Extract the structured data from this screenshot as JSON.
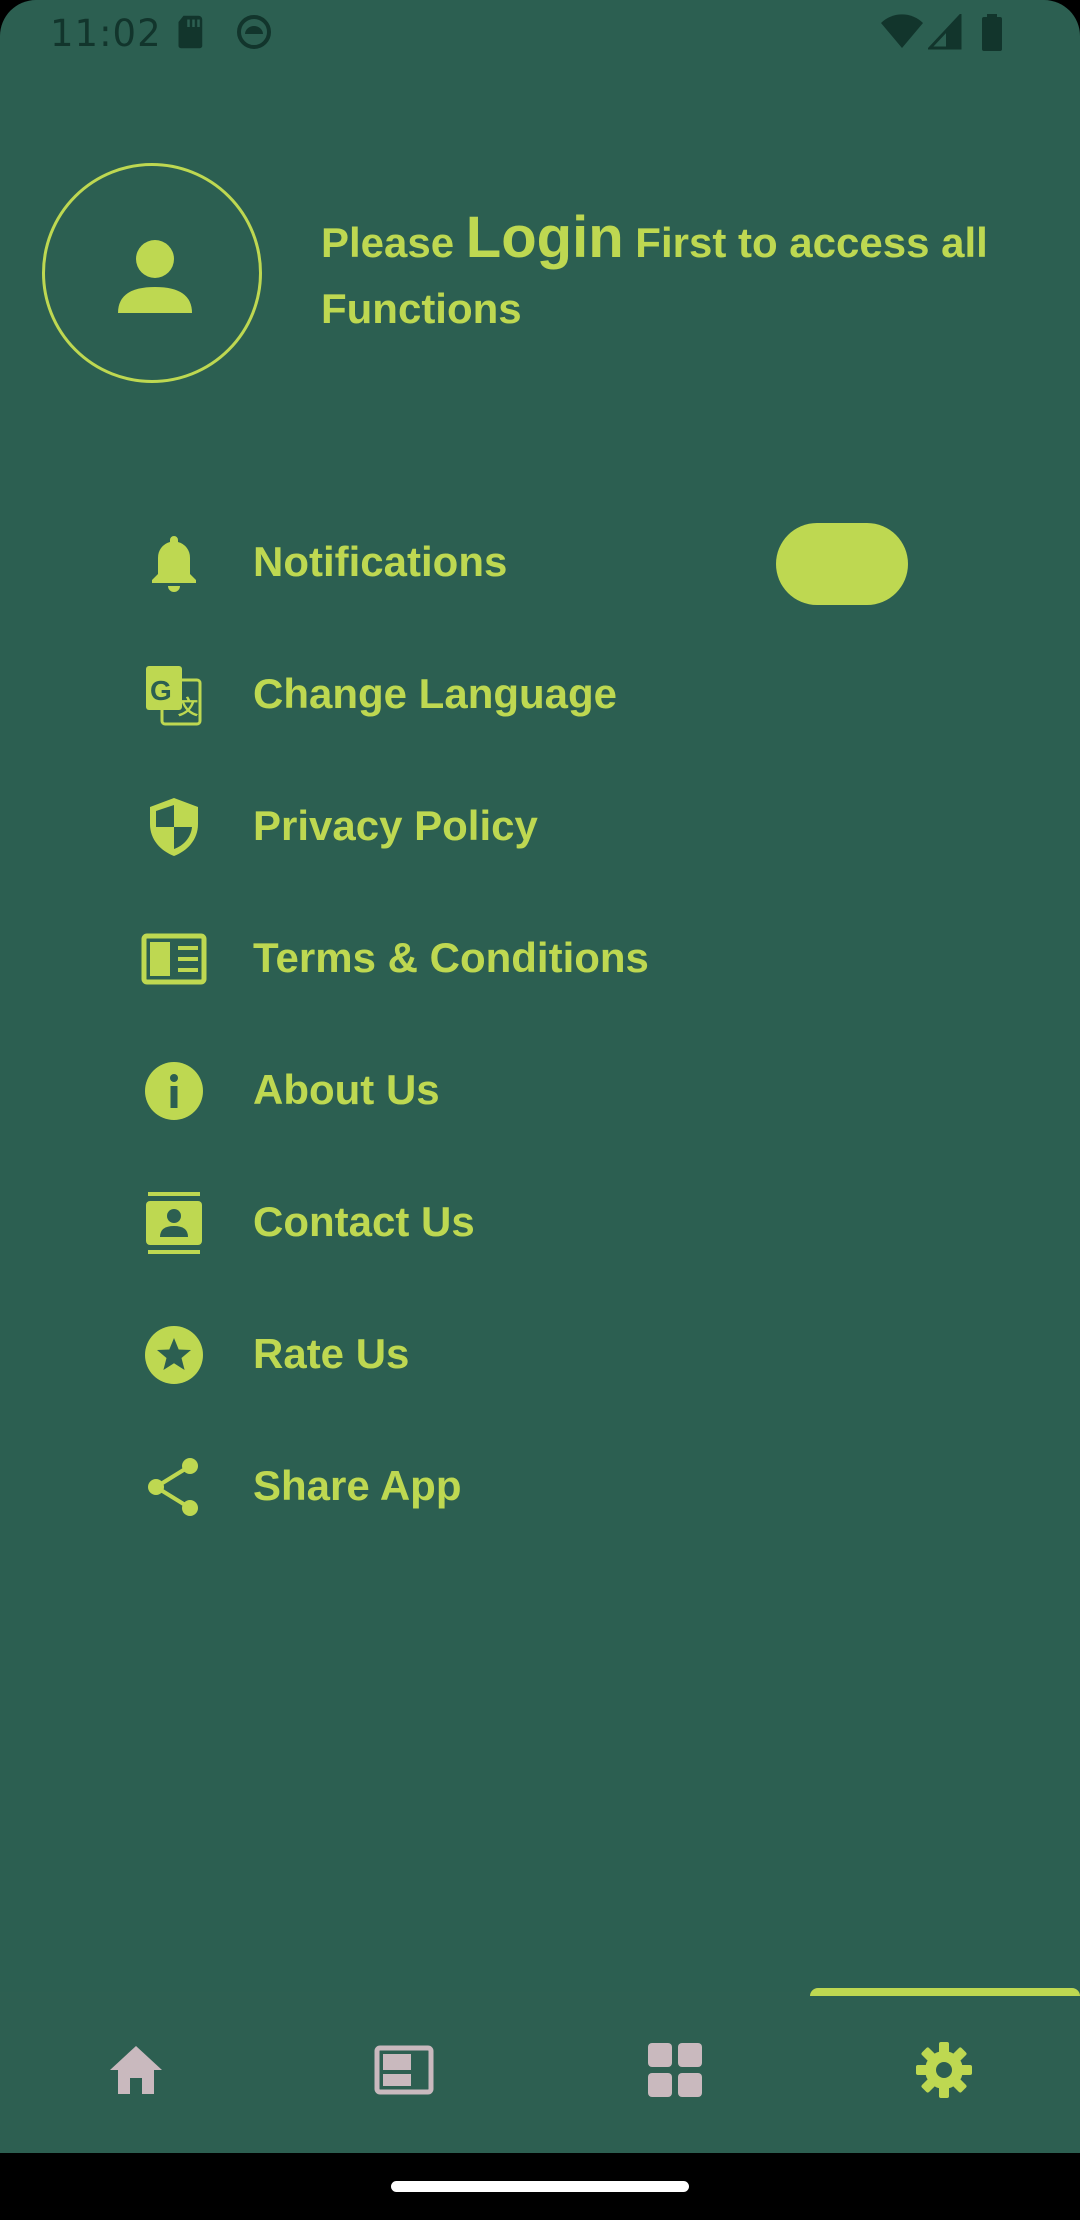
{
  "status_bar": {
    "time": "11:02",
    "icons": [
      "sd-card-icon",
      "android-debug-icon",
      "wifi-icon",
      "signal-icon",
      "battery-icon"
    ]
  },
  "header": {
    "login_prefix": "Please ",
    "login_word": "Login",
    "login_suffix": " First to access all Functions",
    "avatar_icon": "person-icon"
  },
  "menu": {
    "items": [
      {
        "label": "Notifications",
        "icon": "bell-icon"
      },
      {
        "label": "Change Language",
        "icon": "translate-icon"
      },
      {
        "label": "Privacy Policy",
        "icon": "shield-icon"
      },
      {
        "label": "Terms & Conditions",
        "icon": "article-icon"
      },
      {
        "label": "About Us",
        "icon": "info-icon"
      },
      {
        "label": "Contact Us",
        "icon": "contact-icon"
      },
      {
        "label": "Rate Us",
        "icon": "star-icon"
      },
      {
        "label": "Share App",
        "icon": "share-icon"
      }
    ],
    "notifications_toggle": "on"
  },
  "bottom_nav": {
    "items": [
      {
        "icon": "home-icon",
        "selected": false
      },
      {
        "icon": "featured-video-icon",
        "selected": false
      },
      {
        "icon": "grid-icon",
        "selected": false
      },
      {
        "icon": "settings-icon",
        "selected": true
      }
    ]
  },
  "colors": {
    "background": "#2C5F51",
    "accent": "#BED851",
    "nav_inactive": "#C9B9BE"
  }
}
